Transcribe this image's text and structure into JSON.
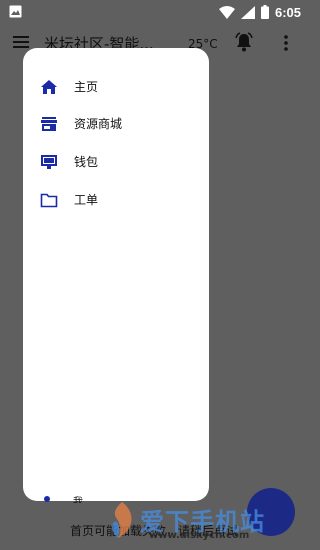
{
  "status_bar": {
    "time": "6:05",
    "icons": [
      "image-icon",
      "wifi-icon",
      "signal-icon",
      "battery-icon"
    ]
  },
  "app_bar": {
    "title": "米坛社区-智能...",
    "temperature": "25°C",
    "icons": [
      "menu-icon",
      "bell-icon",
      "more-icon"
    ]
  },
  "drawer": {
    "items": [
      {
        "label": "主页",
        "icon": "home-icon"
      },
      {
        "label": "资源商城",
        "icon": "store-icon"
      },
      {
        "label": "钱包",
        "icon": "wallet-icon"
      },
      {
        "label": "工单",
        "icon": "folder-icon"
      }
    ],
    "bottom_item_label": "我"
  },
  "background": {
    "bottom_text": "首页可能加载失败，请稍后再试"
  },
  "watermark": {
    "brand": "爱下手机站",
    "url": "www.aiskycn.com"
  },
  "colors": {
    "scrim": "#5f5f5f",
    "drawer_bg": "#ffffff",
    "accent": "#1a2aa8",
    "fab": "#1c2a86"
  }
}
